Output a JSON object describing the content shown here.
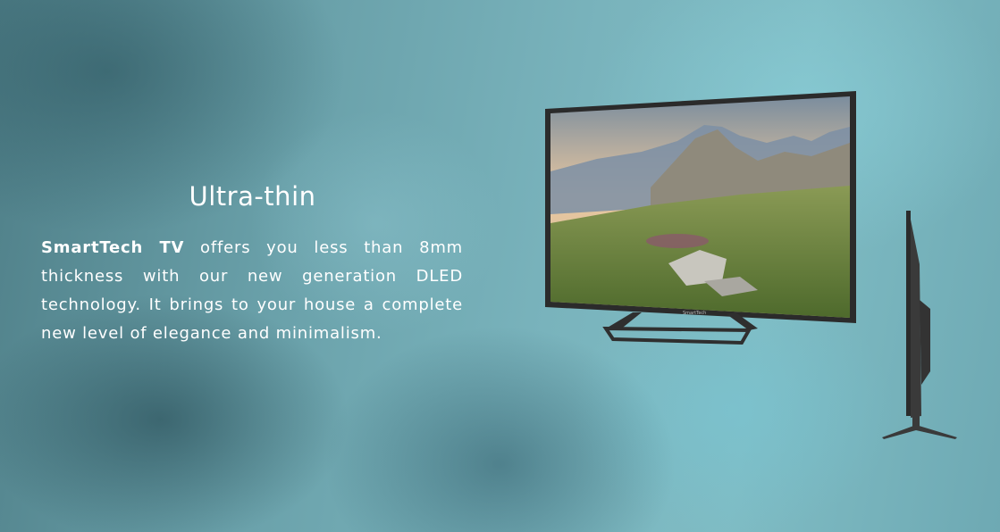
{
  "section": {
    "title": "Ultra-thin",
    "brand": "SmartTech TV",
    "body": " offers you less than 8mm thickness with our new generation DLED  technology. It brings to your house a complete new level  of elegance and minimalism."
  },
  "tv": {
    "logo": "SmartTech"
  },
  "colors": {
    "background": "#6aa1aa",
    "text": "#ffffff",
    "tv_frame": "#2b2b2b"
  }
}
